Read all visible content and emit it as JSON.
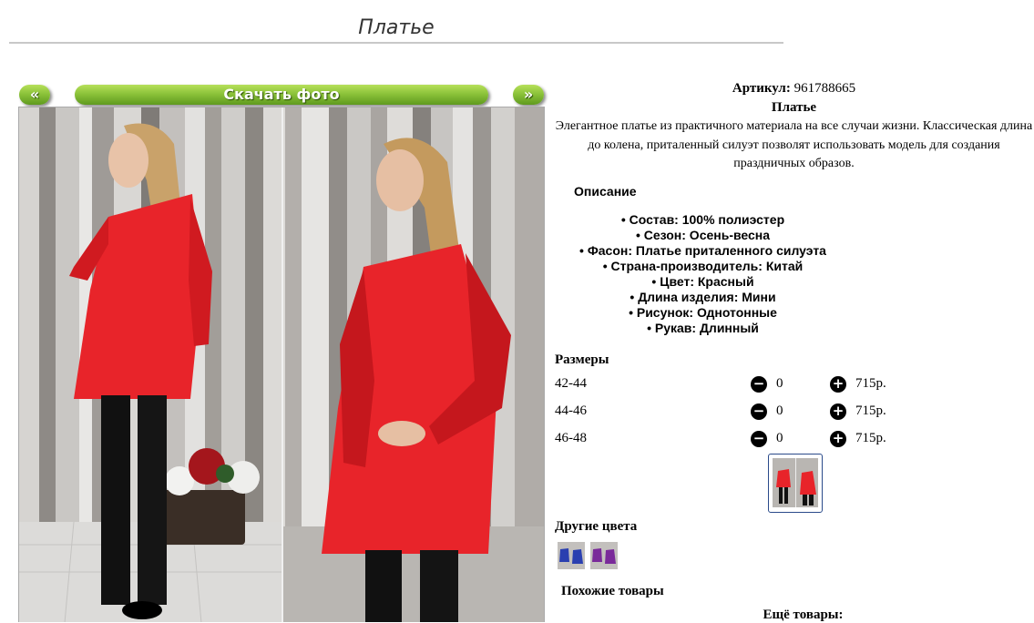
{
  "page": {
    "title": "Платье"
  },
  "gallery": {
    "prev_label": "«",
    "download_label": "Скачать фото",
    "next_label": "»"
  },
  "product": {
    "article_label": "Артикул:",
    "article_value": "961788665",
    "name": "Платье",
    "description": "Элегантное платье из практичного материала на все случаи жизни. Классическая длина до колена, приталенный силуэт позволят использовать модель для создания праздничных образов.",
    "description_heading": "Описание",
    "specs": [
      "Состав: 100% полиэстер",
      "Сезон: Осень-весна",
      "Фасон: Платье приталенного силуэта",
      "Страна-производитель: Китай",
      "Цвет: Красный",
      "Длина изделия: Мини",
      "Рисунок: Однотонные",
      "Рукав: Длинный"
    ]
  },
  "sizes": {
    "heading": "Размеры",
    "minus_icon": "minus-circle-icon",
    "plus_icon": "plus-circle-icon",
    "rows": [
      {
        "label": "42-44",
        "qty": "0",
        "price": "715р."
      },
      {
        "label": "44-46",
        "qty": "0",
        "price": "715р."
      },
      {
        "label": "46-48",
        "qty": "0",
        "price": "715р."
      }
    ]
  },
  "other_colors": {
    "heading": "Другие цвета",
    "swatches": [
      "blue",
      "purple"
    ]
  },
  "similar": {
    "heading": "Похожие товары"
  },
  "more": {
    "heading": "Ещё товары:"
  },
  "colors": {
    "button_green": "#8cc33a",
    "dress_red": "#e8242a",
    "thumb_border": "#2a4a8a"
  }
}
